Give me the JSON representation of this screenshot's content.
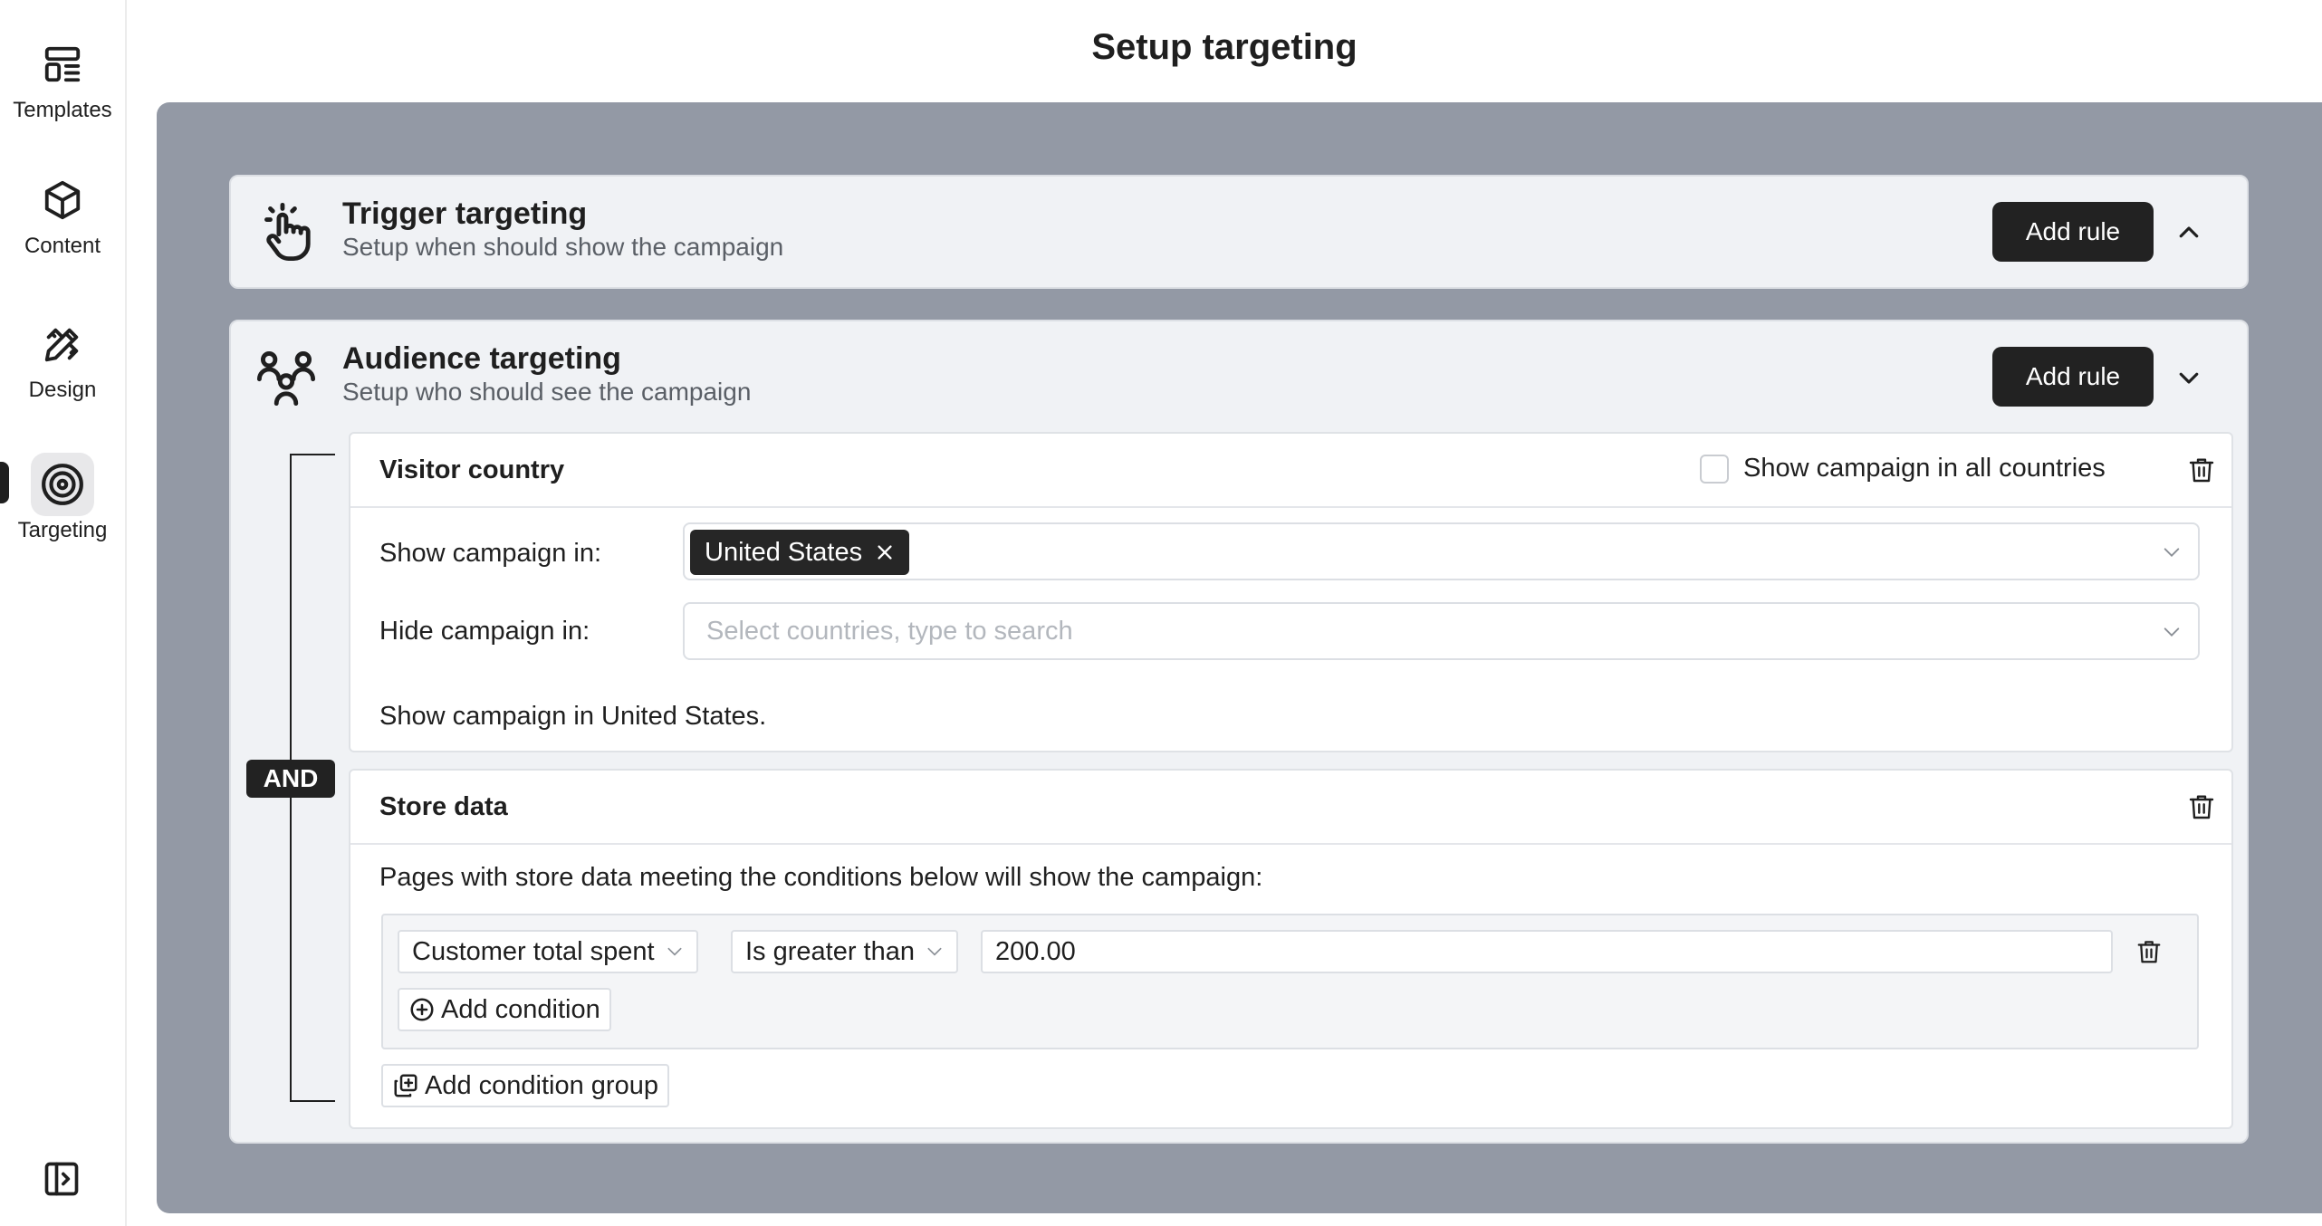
{
  "page": {
    "title": "Setup targeting"
  },
  "sidebar": {
    "items": [
      {
        "label": "Templates",
        "icon": "templates-icon"
      },
      {
        "label": "Content",
        "icon": "cube-icon"
      },
      {
        "label": "Design",
        "icon": "design-icon"
      },
      {
        "label": "Targeting",
        "icon": "target-icon",
        "active": true
      }
    ],
    "collapse_icon": "sidebar-toggle-icon"
  },
  "trigger": {
    "title": "Trigger targeting",
    "subtitle": "Setup when should show the campaign",
    "add_rule": "Add rule",
    "icon": "hand-pointer-icon"
  },
  "audience": {
    "title": "Audience targeting",
    "subtitle": "Setup who should see the campaign",
    "add_rule": "Add rule",
    "icon": "users-icon",
    "operator": "AND",
    "visitor_country": {
      "title": "Visitor country",
      "all_countries_label": "Show campaign in all countries",
      "all_countries_checked": false,
      "show_label": "Show campaign in:",
      "show_tags": [
        "United States"
      ],
      "hide_label": "Hide campaign in:",
      "hide_placeholder": "Select countries, type to search",
      "summary": "Show campaign in United States."
    },
    "store_data": {
      "title": "Store data",
      "description": "Pages with store data meeting the conditions below will show the campaign:",
      "condition": {
        "field": "Customer total spent",
        "operator": "Is greater than",
        "value": "200.00"
      },
      "add_condition": "Add condition",
      "add_condition_group": "Add condition group"
    }
  },
  "colors": {
    "stage": "#9399a5",
    "panel": "#f0f2f5",
    "dark": "#222222"
  }
}
